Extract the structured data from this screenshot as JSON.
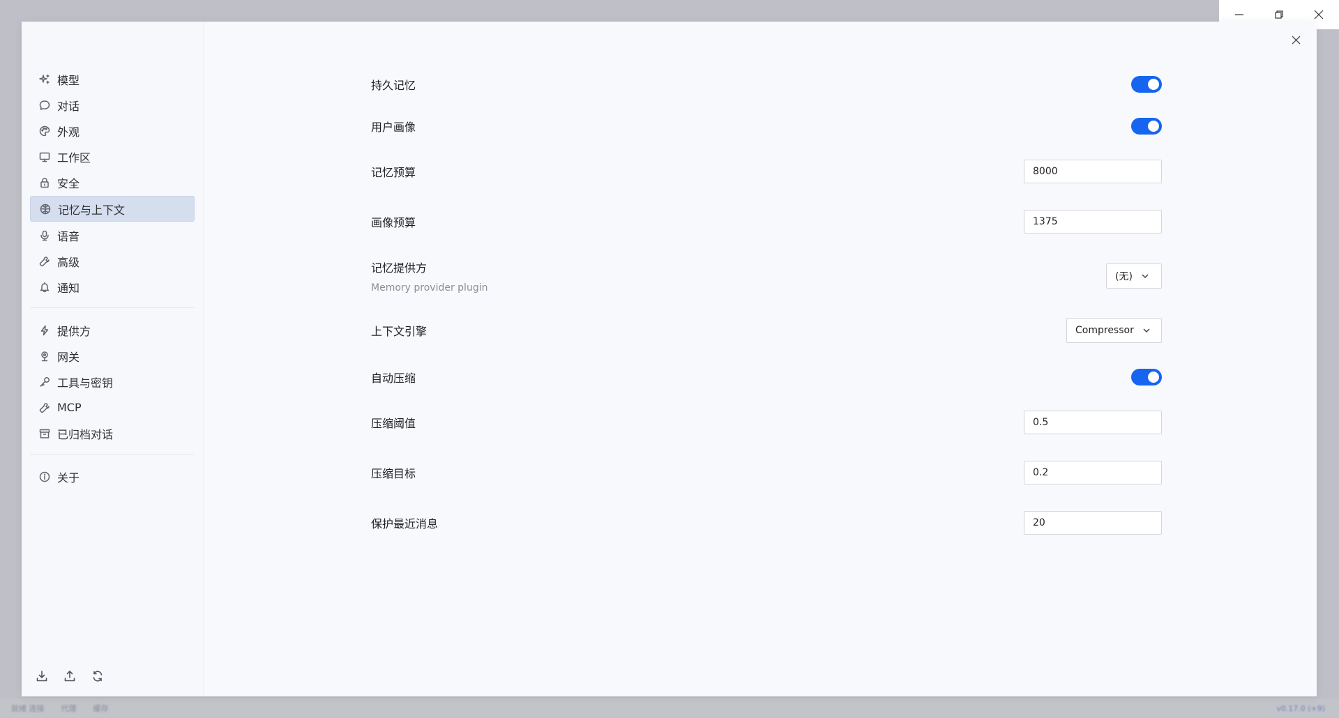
{
  "window": {
    "minimize_icon": "minimize-icon",
    "restore_icon": "restore-icon",
    "close_icon": "close-icon"
  },
  "background_status": {
    "items": [
      "就绪 连接",
      "代理",
      "缓存"
    ],
    "right": "v0.17.0 (+9)"
  },
  "sidebar": {
    "groups": [
      {
        "items": [
          {
            "label": "模型",
            "icon": "sparkle-icon"
          },
          {
            "label": "对话",
            "icon": "chat-bubble-icon"
          },
          {
            "label": "外观",
            "icon": "palette-icon"
          },
          {
            "label": "工作区",
            "icon": "monitor-icon"
          },
          {
            "label": "安全",
            "icon": "lock-icon"
          },
          {
            "label": "记忆与上下文",
            "icon": "brain-icon",
            "active": true
          },
          {
            "label": "语音",
            "icon": "microphone-icon"
          },
          {
            "label": "高级",
            "icon": "wrench-icon"
          },
          {
            "label": "通知",
            "icon": "bell-icon"
          }
        ]
      },
      {
        "items": [
          {
            "label": "提供方",
            "icon": "lightning-icon"
          },
          {
            "label": "网关",
            "icon": "gateway-icon"
          },
          {
            "label": "工具与密钥",
            "icon": "key-icon"
          },
          {
            "label": "MCP",
            "icon": "wrench-icon"
          },
          {
            "label": "已归档对话",
            "icon": "archive-icon"
          }
        ]
      },
      {
        "items": [
          {
            "label": "关于",
            "icon": "info-icon"
          }
        ]
      }
    ],
    "footer": [
      "download-icon",
      "upload-icon",
      "refresh-icon"
    ]
  },
  "settings": {
    "persistent_memory": {
      "label": "持久记忆",
      "enabled": true
    },
    "user_profile": {
      "label": "用户画像",
      "enabled": true
    },
    "memory_budget": {
      "label": "记忆预算",
      "value": "8000"
    },
    "profile_budget": {
      "label": "画像预算",
      "value": "1375"
    },
    "memory_provider": {
      "label": "记忆提供方",
      "sublabel": "Memory provider plugin",
      "selected": "(无)"
    },
    "context_engine": {
      "label": "上下文引擎",
      "selected": "Compressor"
    },
    "auto_compress": {
      "label": "自动压缩",
      "enabled": true
    },
    "compress_threshold": {
      "label": "压缩阈值",
      "value": "0.5"
    },
    "compress_target": {
      "label": "压缩目标",
      "value": "0.2"
    },
    "protect_recent": {
      "label": "保护最近消息",
      "value": "20"
    }
  },
  "colors": {
    "accent": "#1665f0",
    "active_nav": "#d5deef"
  }
}
